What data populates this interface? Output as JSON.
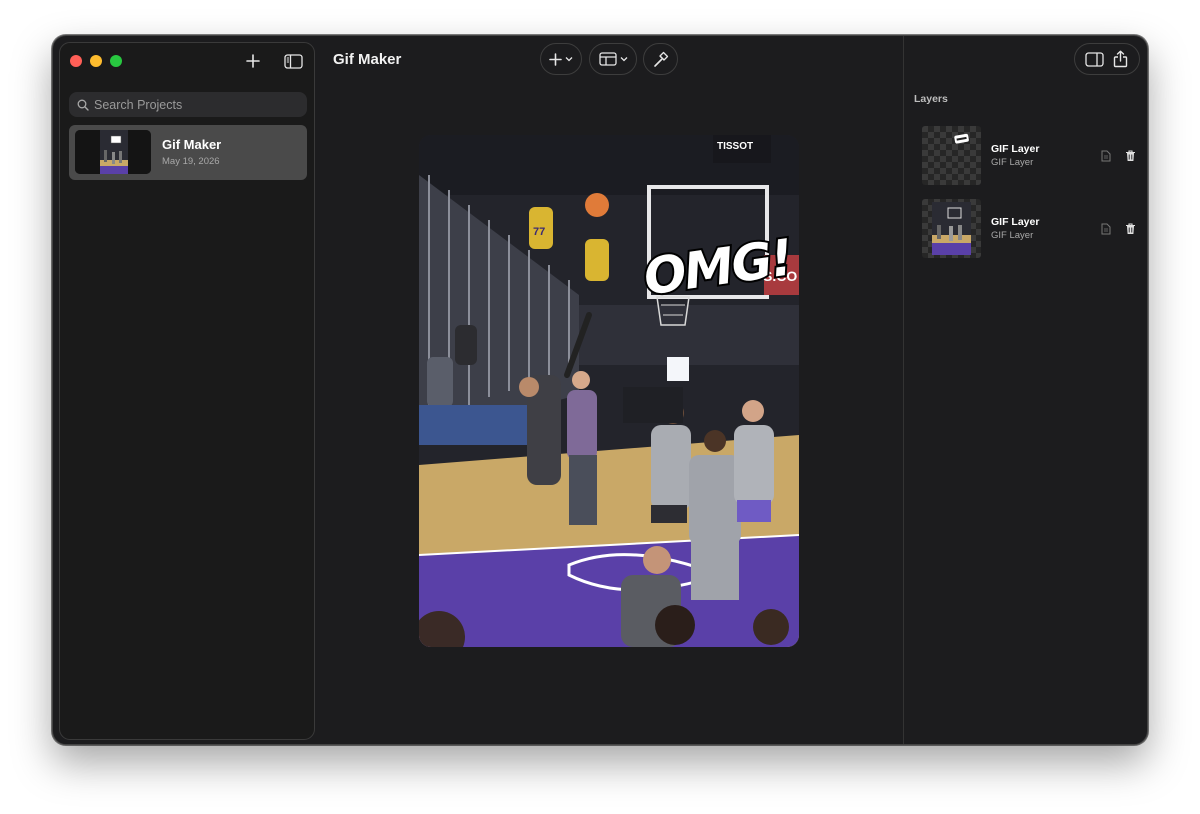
{
  "window": {
    "title": "Gif Maker"
  },
  "sidebar": {
    "new_project_icon": "plus-icon",
    "toggle_icon": "sidebar-icon",
    "search": {
      "placeholder": "Search Projects",
      "value": ""
    },
    "projects": [
      {
        "title": "Gif Maker",
        "date": "May 19, 2026",
        "selected": true
      }
    ]
  },
  "toolbar": {
    "add_icon": "plus-icon",
    "layout_icon": "layout-icon",
    "tool_icon": "hammer-icon"
  },
  "canvas": {
    "sticker_text": "OMG!",
    "scoreboard_text": "TISSOT",
    "banner_text": "S.CO",
    "jersey_number": "77"
  },
  "inspector": {
    "toggle_icon": "inspector-icon",
    "share_icon": "share-icon",
    "layers_title": "Layers",
    "layers": [
      {
        "name": "GIF Layer",
        "type": "GIF Layer"
      },
      {
        "name": "GIF Layer",
        "type": "GIF Layer"
      }
    ]
  },
  "colors": {
    "window_bg": "#1c1c1e",
    "selected_row": "#4a4a4a",
    "court_purple": "#5a40a8",
    "court_wood": "#c9a867"
  }
}
